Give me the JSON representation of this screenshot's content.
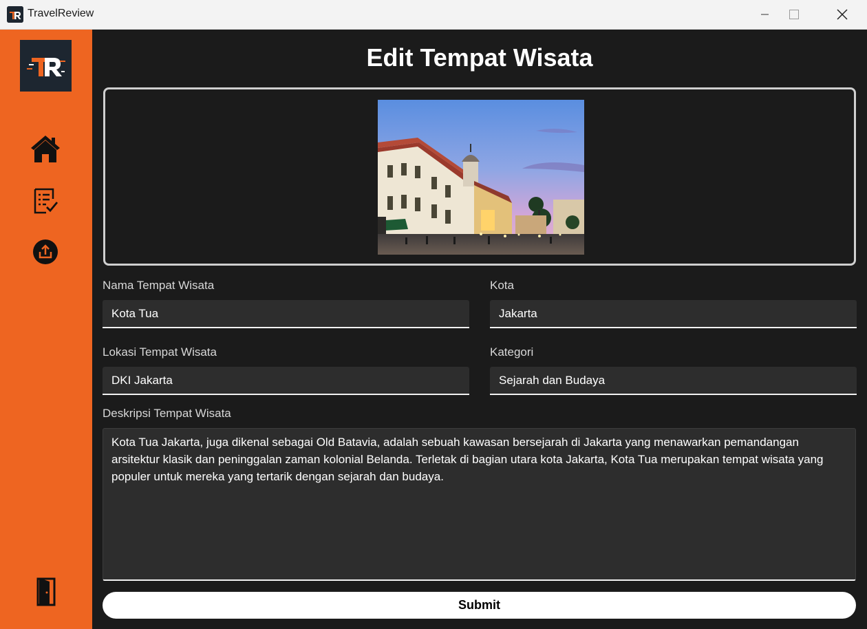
{
  "window": {
    "title": "TravelReview"
  },
  "sidebar": {
    "logo_text": "TR",
    "items": [
      {
        "icon": "home-icon"
      },
      {
        "icon": "checklist-icon"
      },
      {
        "icon": "upload-icon"
      },
      {
        "icon": "logout-door-icon"
      }
    ]
  },
  "page": {
    "title": "Edit Tempat Wisata"
  },
  "form": {
    "nama_label": "Nama Tempat Wisata",
    "nama_value": "Kota Tua",
    "kota_label": "Kota",
    "kota_value": "Jakarta",
    "lokasi_label": "Lokasi Tempat Wisata",
    "lokasi_value": "DKI Jakarta",
    "kategori_label": "Kategori",
    "kategori_value": "Sejarah dan Budaya",
    "deskripsi_label": "Deskripsi Tempat Wisata",
    "deskripsi_value": "Kota Tua Jakarta, juga dikenal sebagai Old Batavia, adalah sebuah kawasan bersejarah di Jakarta yang menawarkan pemandangan arsitektur klasik dan peninggalan zaman kolonial Belanda. Terletak di bagian utara kota Jakarta, Kota Tua merupakan tempat wisata yang populer untuk mereka yang tertarik dengan sejarah dan budaya.",
    "submit_label": "Submit"
  },
  "colors": {
    "sidebar": "#ee6521",
    "background": "#1b1b1b",
    "field": "#2d2d2d"
  }
}
